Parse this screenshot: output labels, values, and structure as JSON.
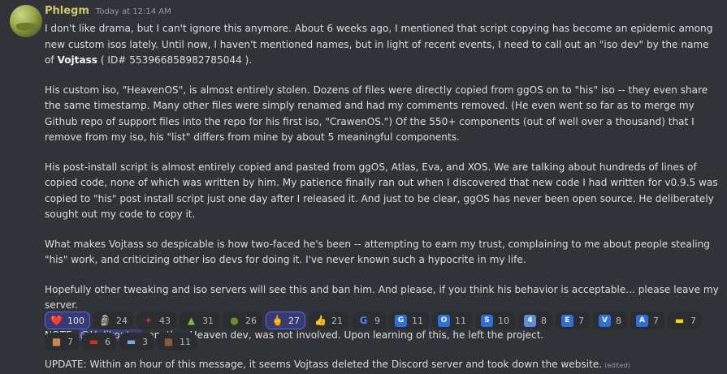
{
  "message": {
    "username": "Phlegm",
    "timestamp": "Today at 12:14 AM",
    "p1_a": "I don't like drama, but I can't ignore this anymore. About 6 weeks ago, I mentioned that script copying has become an epidemic among new custom isos lately. Until now, I haven't mentioned names, but in light of recent events, I need to call out an \"iso dev\" by the name of ",
    "p1_name": "Vojtass",
    "p1_b": " ( ID# 553966858982785044 ).",
    "p2": "His custom iso, \"HeavenOS\", is almost entirely stolen. Dozens of files were directly copied from ggOS on to \"his\" iso -- they even share the same timestamp. Many other files were simply renamed and had my comments removed. (He even went so far as to merge my Github repo of support files into the repo for his first iso, \"CrawenOS.\") Of the 550+ components (out of well over a thousand) that I remove from my iso, his \"list\" differs from mine by about 5 meaningful components.",
    "p3": "His post-install script is almost entirely copied and pasted from ggOS, Atlas, Eva, and XOS. We are talking about hundreds of lines of copied code, none of which was written by him. My patience finally ran out when I discovered that new code I had written for v0.9.5 was copied to \"his\" post install script just one day after I released it. And just to be clear, ggOS has never been open source. He deliberately sought out my code to copy it.",
    "p4": "What makes Vojtass so despicable is how two-faced he's been -- attempting to earn my trust, complaining to me about people stealing \"his\" work, and criticizing other iso devs for doing it. I've never known such a hypocrite in my life.",
    "p5": "Hopefully other tweaking and iso servers will see this and ban him. And please, if you think his behavior is acceptable... please leave my server.",
    "p6_a": "NOTE:  ",
    "p6_mention": "@Helikopter",
    "p6_b": ", another Heaven dev, was not involved. Upon learning of this, he left the project.",
    "p7": "UPDATE:  Within an hour of this message, it seems Vojtass deleted the Discord server and took down the website.",
    "edited": "(edited)"
  },
  "reactions": [
    {
      "emoji": "❤️",
      "icon": "red-heart-icon",
      "count": "100",
      "active": true,
      "bg": "",
      "fg": "#f23f43"
    },
    {
      "emoji": "🗿",
      "icon": "moai-icon",
      "count": "24",
      "active": false,
      "bg": "",
      "fg": "#9a9a9a"
    },
    {
      "emoji": "✦",
      "icon": "custom-sparkle-icon",
      "count": "43",
      "active": false,
      "bg": "",
      "fg": "#c0392b"
    },
    {
      "emoji": "▲",
      "icon": "custom-green-icon",
      "count": "31",
      "active": false,
      "bg": "",
      "fg": "#7cbc3c"
    },
    {
      "emoji": "●",
      "icon": "custom-blob-icon",
      "count": "26",
      "active": false,
      "bg": "",
      "fg": "#6a8f2a"
    },
    {
      "emoji": "🖕",
      "icon": "middle-finger-icon",
      "count": "27",
      "active": true,
      "bg": "",
      "fg": "#f5c542"
    },
    {
      "emoji": "👍",
      "icon": "thumbs-up-icon",
      "count": "21",
      "active": false,
      "bg": "",
      "fg": "#f5c542"
    },
    {
      "emoji": "G",
      "icon": "google-g-icon",
      "count": "9",
      "active": false,
      "bg": "",
      "fg": "#4285f4"
    },
    {
      "emoji": "G",
      "icon": "letter-g-icon",
      "count": "11",
      "active": false,
      "bg": "#2f6fd6",
      "fg": "#ffffff"
    },
    {
      "emoji": "O",
      "icon": "letter-o-icon",
      "count": "11",
      "active": false,
      "bg": "#2f6fd6",
      "fg": "#ffffff"
    },
    {
      "emoji": "S",
      "icon": "letter-s-icon",
      "count": "10",
      "active": false,
      "bg": "#2f6fd6",
      "fg": "#ffffff"
    },
    {
      "emoji": "4",
      "icon": "keycap-4-icon",
      "count": "8",
      "active": false,
      "bg": "#5b8fd4",
      "fg": "#ffffff"
    },
    {
      "emoji": "E",
      "icon": "letter-e-icon",
      "count": "7",
      "active": false,
      "bg": "#2f6fd6",
      "fg": "#ffffff"
    },
    {
      "emoji": "V",
      "icon": "letter-v-icon",
      "count": "8",
      "active": false,
      "bg": "#2f6fd6",
      "fg": "#ffffff"
    },
    {
      "emoji": "A",
      "icon": "letter-a-icon",
      "count": "7",
      "active": false,
      "bg": "#2f6fd6",
      "fg": "#ffffff"
    },
    {
      "emoji": "▬",
      "icon": "ukraine-flag-icon",
      "count": "7",
      "active": false,
      "bg": "",
      "fg": "#f7d20a"
    },
    {
      "emoji": "■",
      "icon": "custom-face-icon",
      "count": "7",
      "active": false,
      "bg": "",
      "fg": "#c9865a"
    },
    {
      "emoji": "▬",
      "icon": "russia-flag-icon",
      "count": "6",
      "active": false,
      "bg": "",
      "fg": "#d52b1e"
    },
    {
      "emoji": "▬",
      "icon": "argentina-flag-icon",
      "count": "3",
      "active": false,
      "bg": "",
      "fg": "#74acdf"
    },
    {
      "emoji": "■",
      "icon": "custom-photo-icon",
      "count": "11",
      "active": false,
      "bg": "",
      "fg": "#8b5a3c"
    }
  ]
}
